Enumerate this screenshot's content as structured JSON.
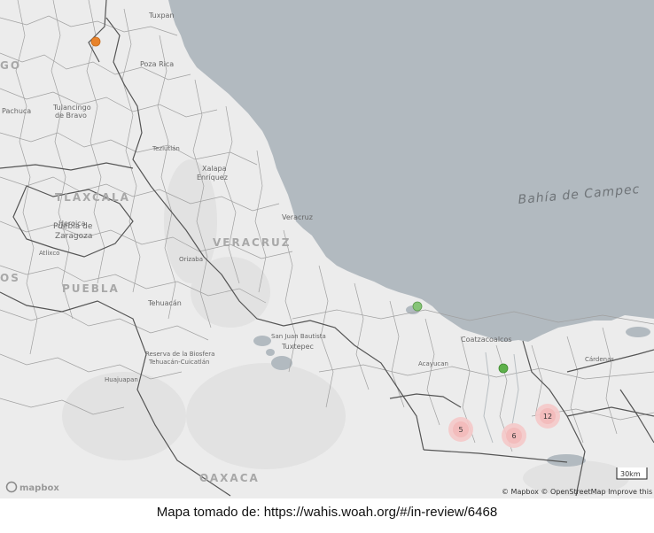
{
  "map": {
    "colors": {
      "land": "#ececec",
      "water": "#b2bac0",
      "border": "#555555",
      "minor_border": "#9a9a9a",
      "cluster_fill": "#f5c9c9",
      "marker_orange": "#e8832b",
      "marker_green": "#5db04a"
    },
    "water_labels": {
      "bay": "Bahía de Campec"
    },
    "state_labels": {
      "tlaxcala": "TLAXCALA",
      "veracruz": "VERACRUZ",
      "puebla": "PUEBLA",
      "oaxaca": "OAXACA"
    },
    "city_labels": {
      "tuxpan": "Tuxpan",
      "poza_rica": "Poza Rica",
      "pachuca": "Pachuca",
      "tulancingo": "Tulancingo",
      "de_bravo": "de Bravo",
      "teziutlan": "Teziutlán",
      "xalapa": "Xalapa",
      "enriquez": "Enríquez",
      "veracruz_city": "Veracruz",
      "heroica": "Heroica",
      "puebla_de": "Puebla de",
      "zaragoza": "Zaragoza",
      "atlixco": "Atlixco",
      "orizaba": "Orizaba",
      "tehuacan": "Tehuacán",
      "san_juan_bautista": "San Juan Bautista",
      "tuxtepec": "Tuxtepec",
      "reserva": "Reserva de la Biosfera",
      "tehuacan_cuicatlan": "Tehuacán-Cuicatlán",
      "huajuapan": "Huajuapan",
      "coatzacoalcos": "Coatzacoalcos",
      "acayucan": "Acayucan",
      "cardenas": "Cárdenas",
      "edge_left": "GO",
      "edge_left2": "OS"
    },
    "clusters": [
      {
        "count": "5"
      },
      {
        "count": "6"
      },
      {
        "count": "12"
      }
    ],
    "markers": [
      {
        "name": "orange-outbreak-marker",
        "color": "#e8832b"
      },
      {
        "name": "green-outbreak-marker-1",
        "color": "#5db04a"
      },
      {
        "name": "green-outbreak-marker-2",
        "color": "#5db04a"
      }
    ],
    "logo_text": "mapbox",
    "attribution": "© Mapbox  © OpenStreetMap  Improve this map",
    "scale_label": "30km"
  },
  "caption": "Mapa tomado de: https://wahis.woah.org/#/in-review/6468"
}
